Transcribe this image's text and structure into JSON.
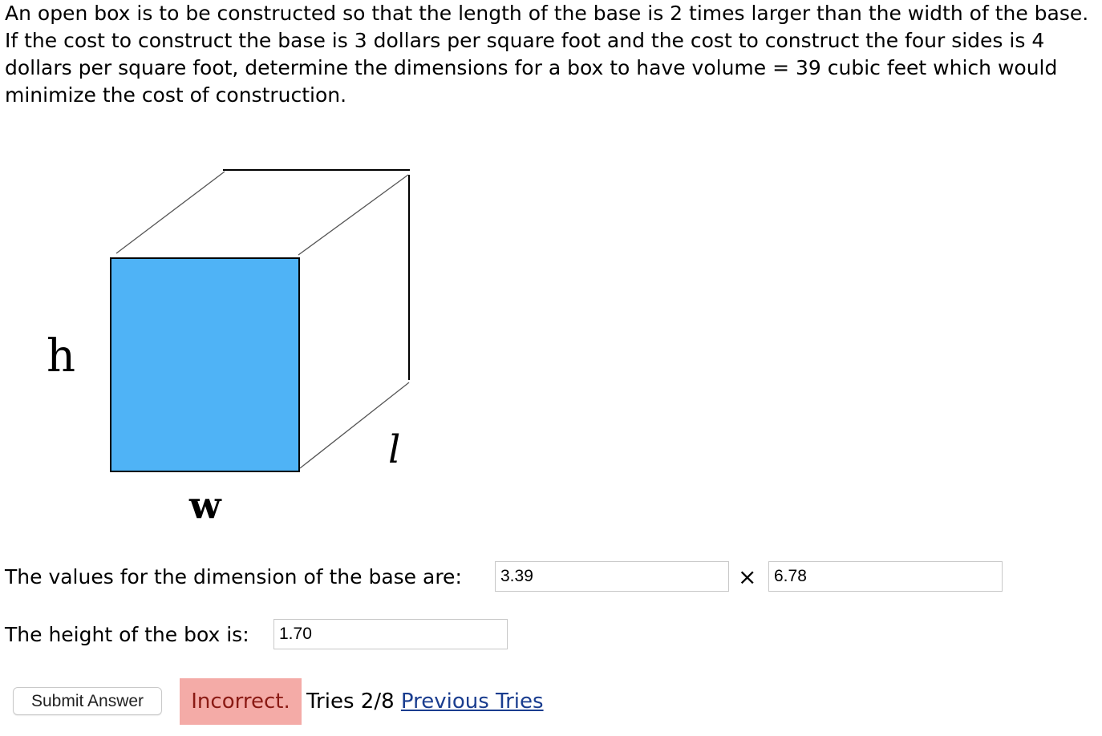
{
  "problem": {
    "text": "An open box is to be constructed so that the length of the base is 2 times larger than the width of the base. If the cost to construct the base is 3 dollars per square foot and the cost to construct the four sides is 4 dollars per square foot, determine the dimensions for a box to have volume = 39 cubic feet which would minimize the cost of construction."
  },
  "figure": {
    "label_h": "h",
    "label_w": "w",
    "label_l": "l",
    "face_color": "#4fb3f6"
  },
  "base_row": {
    "label": "The values for the dimension of the base are:",
    "value1": "3.39",
    "times": "×",
    "value2": "6.78"
  },
  "height_row": {
    "label": "The height of the box is:",
    "value": "1.70"
  },
  "footer": {
    "submit_label": "Submit Answer",
    "status": "Incorrect.",
    "tries": "Tries 2/8",
    "previous_tries": "Previous Tries"
  },
  "colors": {
    "status_bg": "#f4aba7",
    "status_text": "#8a1a14",
    "link": "#1a3d8f"
  }
}
